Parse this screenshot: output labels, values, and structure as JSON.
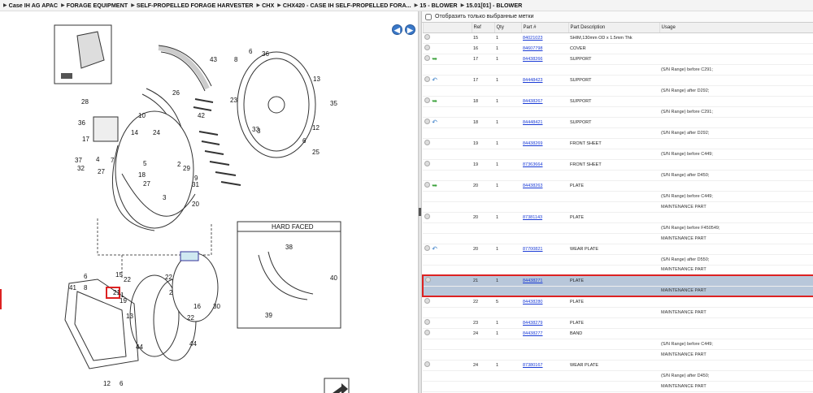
{
  "breadcrumb": [
    "Case IH AG APAC",
    "FORAGE EQUIPMENT",
    "SELF-PROPELLED FORAGE HARVESTER",
    "CHX",
    "CHX420 - CASE IH SELF-PROPELLED FORA...",
    "15 - BLOWER",
    "15.01[01] - BLOWER"
  ],
  "nav": {
    "back": "◀",
    "forward": "▶"
  },
  "filter_label": "Отобразить только выбранные метки",
  "columns": [
    "Ref",
    "Qty",
    "Part #",
    "Part Description",
    "Usage"
  ],
  "diagram": {
    "hard_faced_label": "HARD FACED",
    "callouts": [
      "43",
      "8",
      "36",
      "6",
      "13",
      "26",
      "42",
      "23",
      "28",
      "10",
      "36",
      "35",
      "17",
      "14",
      "24",
      "3",
      "33",
      "12",
      "6",
      "25",
      "37",
      "4",
      "7",
      "32",
      "27",
      "5",
      "29",
      "2",
      "9",
      "18",
      "31",
      "27",
      "20",
      "3",
      "1",
      "21",
      "19",
      "15",
      "22",
      "22",
      "2",
      "41",
      "6",
      "8",
      "13",
      "22",
      "44",
      "44",
      "12",
      "6",
      "38",
      "40",
      "39",
      "16",
      "30"
    ]
  },
  "rows": [
    {
      "ref": "15",
      "qty": "1",
      "part": "84021023",
      "desc": "SHIM,130mm OD x 1.5mm Thk",
      "usage": "",
      "icon": "",
      "sel": false
    },
    {
      "ref": "16",
      "qty": "1",
      "part": "84607798",
      "desc": "COVER",
      "usage": "",
      "icon": "",
      "sel": false
    },
    {
      "ref": "17",
      "qty": "1",
      "part": "84438266",
      "desc": "SUPPORT",
      "usage": "",
      "icon": "green",
      "sel": false
    },
    {
      "ref": "",
      "qty": "",
      "part": "",
      "desc": "",
      "usage": "(S/N Range) before C291;",
      "icon": "",
      "sel": false
    },
    {
      "ref": "17",
      "qty": "1",
      "part": "84448423",
      "desc": "SUPPORT",
      "usage": "",
      "icon": "blue",
      "sel": false
    },
    {
      "ref": "",
      "qty": "",
      "part": "",
      "desc": "",
      "usage": "(S/N Range) after D292;",
      "icon": "",
      "sel": false
    },
    {
      "ref": "18",
      "qty": "1",
      "part": "84438267",
      "desc": "SUPPORT",
      "usage": "",
      "icon": "green",
      "sel": false
    },
    {
      "ref": "",
      "qty": "",
      "part": "",
      "desc": "",
      "usage": "(S/N Range) before C291;",
      "icon": "",
      "sel": false
    },
    {
      "ref": "18",
      "qty": "1",
      "part": "84448421",
      "desc": "SUPPORT",
      "usage": "",
      "icon": "blue",
      "sel": false
    },
    {
      "ref": "",
      "qty": "",
      "part": "",
      "desc": "",
      "usage": "(S/N Range) after D292;",
      "icon": "",
      "sel": false
    },
    {
      "ref": "19",
      "qty": "1",
      "part": "84438269",
      "desc": "FRONT SHEET",
      "usage": "",
      "icon": "",
      "sel": false
    },
    {
      "ref": "",
      "qty": "",
      "part": "",
      "desc": "",
      "usage": "(S/N Range) before C449;",
      "icon": "",
      "sel": false
    },
    {
      "ref": "19",
      "qty": "1",
      "part": "87363664",
      "desc": "FRONT SHEET",
      "usage": "",
      "icon": "",
      "sel": false
    },
    {
      "ref": "",
      "qty": "",
      "part": "",
      "desc": "",
      "usage": "(S/N Range) after D450;",
      "icon": "",
      "sel": false
    },
    {
      "ref": "20",
      "qty": "1",
      "part": "84438263",
      "desc": "PLATE",
      "usage": "",
      "icon": "green",
      "sel": false
    },
    {
      "ref": "",
      "qty": "",
      "part": "",
      "desc": "",
      "usage": "(S/N Range) before C449;",
      "icon": "",
      "sel": false
    },
    {
      "ref": "",
      "qty": "",
      "part": "",
      "desc": "",
      "usage": "MAINTENANCE PART",
      "icon": "",
      "sel": false
    },
    {
      "ref": "20",
      "qty": "1",
      "part": "87381143",
      "desc": "PLATE",
      "usage": "",
      "icon": "",
      "sel": false
    },
    {
      "ref": "",
      "qty": "",
      "part": "",
      "desc": "",
      "usage": "(S/N Range) before F450549;",
      "icon": "",
      "sel": false
    },
    {
      "ref": "",
      "qty": "",
      "part": "",
      "desc": "",
      "usage": "MAINTENANCE PART",
      "icon": "",
      "sel": false
    },
    {
      "ref": "20",
      "qty": "1",
      "part": "87700821",
      "desc": "WEAR PLATE",
      "usage": "",
      "icon": "blue",
      "sel": false
    },
    {
      "ref": "",
      "qty": "",
      "part": "",
      "desc": "",
      "usage": "(S/N Range) after D550;",
      "icon": "",
      "sel": false
    },
    {
      "ref": "",
      "qty": "",
      "part": "",
      "desc": "",
      "usage": "MAINTENANCE PART",
      "icon": "",
      "sel": false
    },
    {
      "ref": "21",
      "qty": "1",
      "part": "84438271",
      "desc": "PLATE",
      "usage": "",
      "icon": "",
      "sel": true
    },
    {
      "ref": "",
      "qty": "",
      "part": "",
      "desc": "",
      "usage": "MAINTENANCE PART",
      "icon": "",
      "sel": true
    },
    {
      "ref": "22",
      "qty": "5",
      "part": "84438280",
      "desc": "PLATE",
      "usage": "",
      "icon": "",
      "sel": false
    },
    {
      "ref": "",
      "qty": "",
      "part": "",
      "desc": "",
      "usage": "MAINTENANCE PART",
      "icon": "",
      "sel": false
    },
    {
      "ref": "23",
      "qty": "1",
      "part": "84438279",
      "desc": "PLATE",
      "usage": "",
      "icon": "",
      "sel": false
    },
    {
      "ref": "24",
      "qty": "1",
      "part": "84438277",
      "desc": "BAND",
      "usage": "",
      "icon": "",
      "sel": false
    },
    {
      "ref": "",
      "qty": "",
      "part": "",
      "desc": "",
      "usage": "(S/N Range) before C449;",
      "icon": "",
      "sel": false
    },
    {
      "ref": "",
      "qty": "",
      "part": "",
      "desc": "",
      "usage": "MAINTENANCE PART",
      "icon": "",
      "sel": false
    },
    {
      "ref": "24",
      "qty": "1",
      "part": "87380167",
      "desc": "WEAR PLATE",
      "usage": "",
      "icon": "",
      "sel": false
    },
    {
      "ref": "",
      "qty": "",
      "part": "",
      "desc": "",
      "usage": "(S/N Range) after D450;",
      "icon": "",
      "sel": false
    },
    {
      "ref": "",
      "qty": "",
      "part": "",
      "desc": "",
      "usage": "MAINTENANCE PART",
      "icon": "",
      "sel": false
    }
  ]
}
